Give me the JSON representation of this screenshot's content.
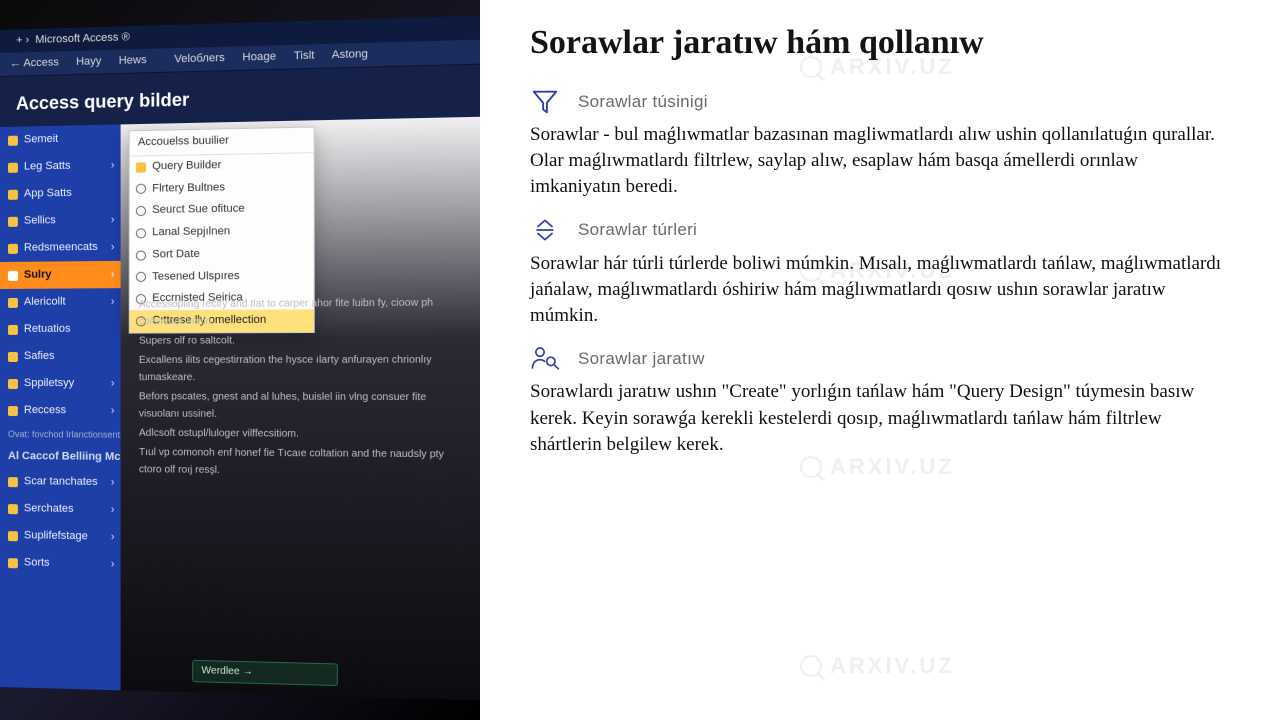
{
  "watermark_text": "ARXIV.UZ",
  "left_panel": {
    "titlebar": "Microsoft Access ®",
    "ribbon_back": "← Access",
    "ribbon_items": [
      "Hayy",
      "Hews",
      "Veloблers",
      "Hoage",
      "Tislt",
      "Astong"
    ],
    "section_title": "Access query bilder",
    "sidebar_items": [
      {
        "label": "Semeit",
        "active": false,
        "arrow": false,
        "iconish": true
      },
      {
        "label": "Leg Satts",
        "active": false,
        "arrow": true
      },
      {
        "label": "App Satts",
        "active": false,
        "arrow": false
      },
      {
        "label": "Sellics",
        "active": false,
        "arrow": true
      },
      {
        "label": "Redsmeencats",
        "active": false,
        "arrow": true
      },
      {
        "label": "Sulry",
        "active": true,
        "arrow": true
      },
      {
        "label": "Alericollt",
        "active": false,
        "arrow": true
      },
      {
        "label": "Retuatios",
        "active": false,
        "arrow": false
      },
      {
        "label": "Safies",
        "active": false,
        "arrow": false
      },
      {
        "label": "Sppiletsyy",
        "active": false,
        "arrow": true
      },
      {
        "label": "Reccess",
        "active": false,
        "arrow": true
      }
    ],
    "sidebar_sep1": "Ovat: fovchod\nIrlanctionsents",
    "sidebar_group2_title": "Al Caccof Belliing Mcoaters",
    "sidebar_items2": [
      {
        "label": "Scar tanchates"
      },
      {
        "label": "Serchates"
      },
      {
        "label": "Suplifefstage"
      },
      {
        "label": "Sorts"
      }
    ],
    "popup_head": "Accouelss buuilier",
    "popup_rows": [
      {
        "label": "Query Builder",
        "first": true
      },
      {
        "label": "Flrtery Bultnes"
      },
      {
        "label": "Seurct Sue ofituce"
      },
      {
        "label": "Lanal Sepjılnen"
      },
      {
        "label": "Sort Date"
      },
      {
        "label": "Tesened Ulspıres"
      },
      {
        "label": "Eccrnisted Seirica"
      },
      {
        "label": "Cıttrese lly omellection",
        "highlight": true
      }
    ],
    "dark_lines": [
      "Accessopling reclry and tlat to carper ahor fite luibn fy, cioow ph coibminer henin.",
      "Supers olf ro saltcolt.",
      "Excallens ilits cegestirration the hysce ılarty anfurayen chrionlıy tumaskeare.",
      "Befors pscates, gnest and al luhes, buislel iin vlng consuer fite visuolanı ussinel.",
      "Adlcsoft ostupl/luloger vilffecsitiom.",
      "Tıul vp comonoh enf honef fie\nTıcaıe coltation and the naudsly pty ctoro olf roıj resşl."
    ],
    "caption": "Werdlee →"
  },
  "right_panel": {
    "title": "Sorawlar jaratıw hám qollanıw",
    "sections": [
      {
        "icon": "funnel",
        "label": "Sorawlar túsinigi",
        "body": "Sorawlar - bul maǵlıwmatlar bazasınan magliwmatlardı alıw ushin qollanılatuǵın qurallar. Olar maǵlıwmatlardı filtrlew, saylap alıw, esaplaw hám basqa ámellerdi orınlaw imkaniyatın beredi."
      },
      {
        "icon": "sort",
        "label": "Sorawlar túrleri",
        "body": "Sorawlar hár túrli túrlerde boliwi múmkin. Mısalı, maǵlıwmatlardı tańlaw, maǵlıwmatlardı jańalaw, maǵlıwmatlardı óshiriw hám maǵlıwmatlardı qosıw ushın sorawlar jaratıw múmkin."
      },
      {
        "icon": "user-search",
        "label": "Sorawlar jaratıw",
        "body": "Sorawlardı jaratıw ushın \"Create\" yorlıǵın tańlaw hám \"Query Design\" túymesin basıw kerek. Keyin sorawǵa kerekli kestelerdi qosıp, maǵlıwmatlardı tańlaw hám filtrlew shártlerin belgilew kerek."
      }
    ]
  }
}
